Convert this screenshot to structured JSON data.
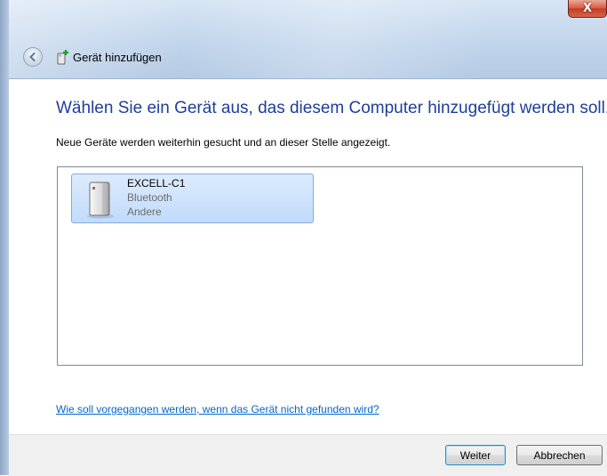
{
  "window": {
    "close_glyph": "X"
  },
  "nav": {
    "title": "Gerät hinzufügen"
  },
  "main": {
    "headline": "Wählen Sie ein Gerät aus, das diesem Computer hinzugefügt werden soll.",
    "subline": "Neue Geräte werden weiterhin gesucht und an dieser Stelle angezeigt.",
    "devices": [
      {
        "name": "EXCELL-C1",
        "type": "Bluetooth",
        "category": "Andere",
        "icon": "generic-device-icon"
      }
    ],
    "help_link": "Wie soll vorgegangen werden, wenn das Gerät nicht gefunden wird?"
  },
  "footer": {
    "next_label": "Weiter",
    "cancel_label": "Abbrechen"
  },
  "colors": {
    "headline": "#1e3f9a",
    "link": "#0066cc",
    "selection": "#c1dbfc"
  }
}
